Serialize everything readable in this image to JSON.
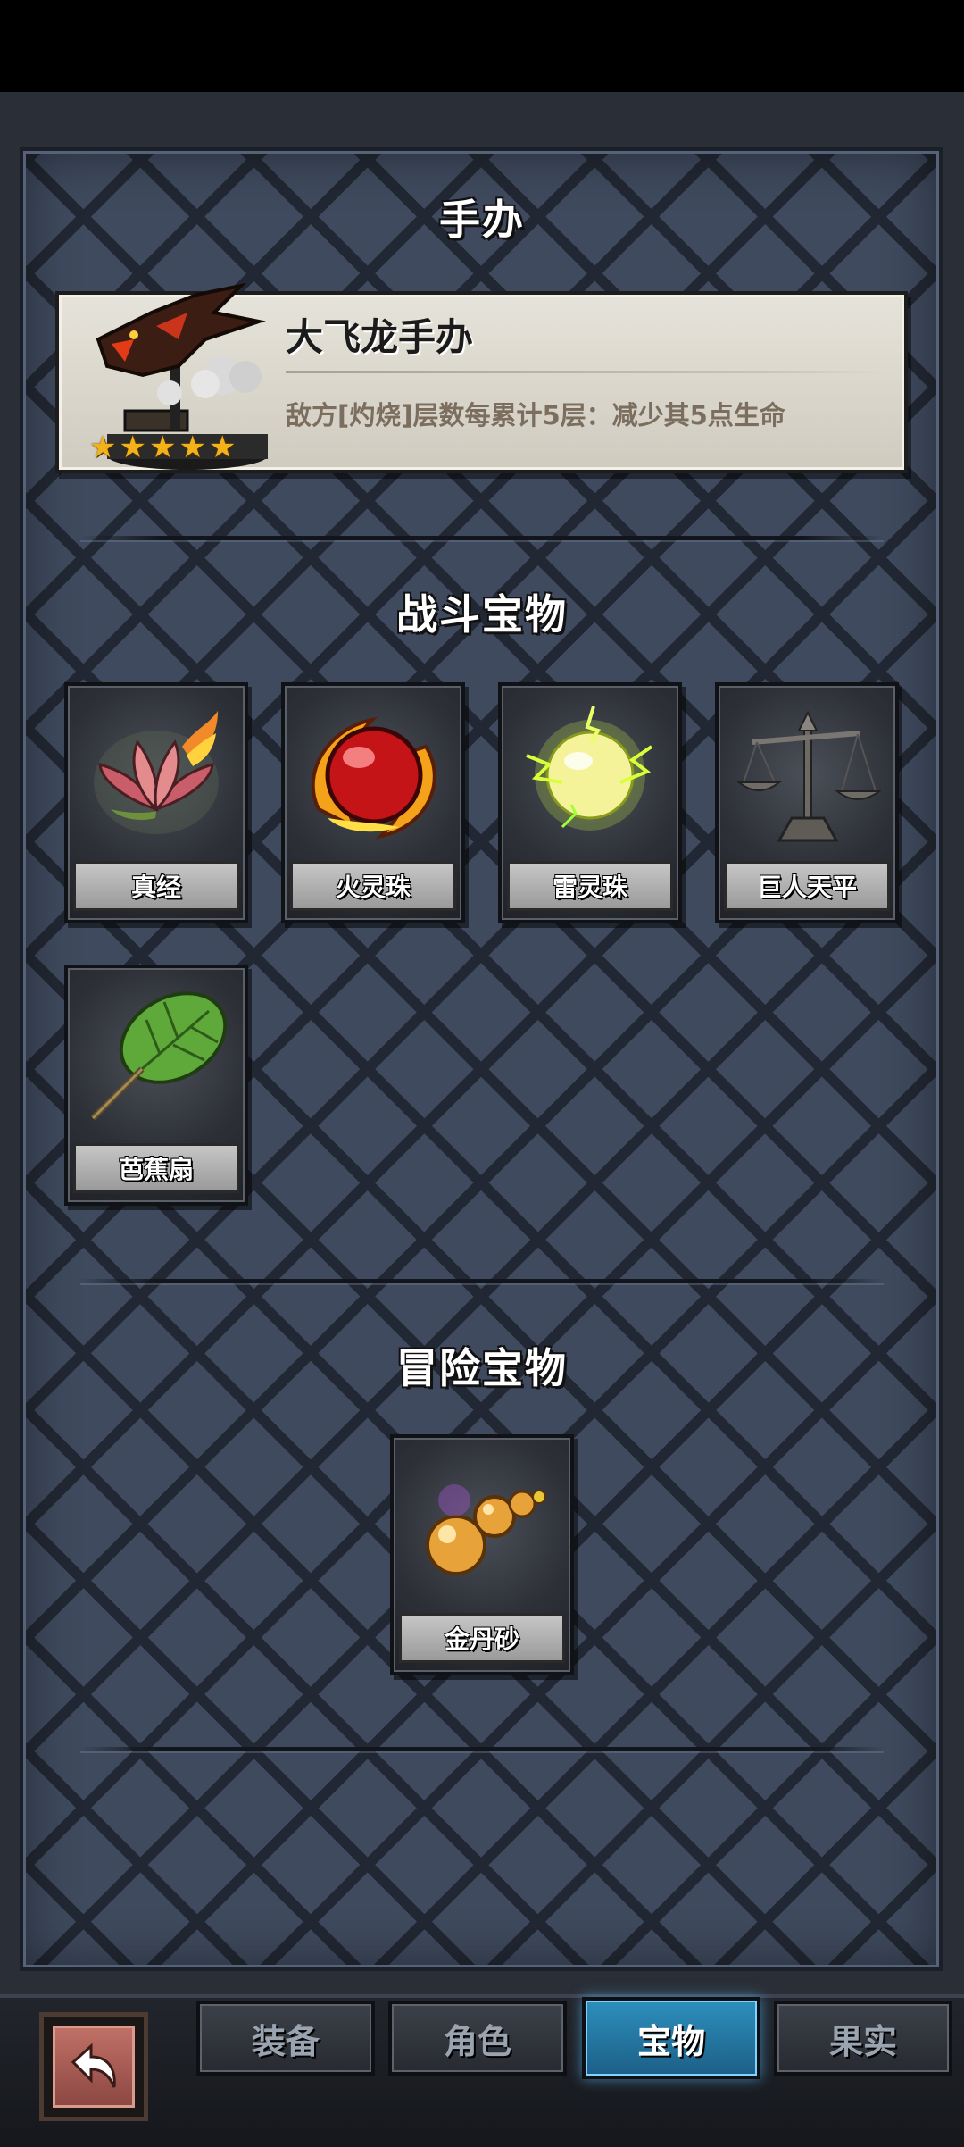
{
  "sections": {
    "figure_title": "手办",
    "battle_title": "战斗宝物",
    "adventure_title": "冒险宝物"
  },
  "figure": {
    "name": "大飞龙手办",
    "description": "敌方[灼烧]层数每累计5层：减少其5点生命",
    "stars": 5,
    "star_glyph": "★"
  },
  "battle_treasures": [
    {
      "name": "真经",
      "icon": "lotus-icon"
    },
    {
      "name": "火灵珠",
      "icon": "fire-orb-icon"
    },
    {
      "name": "雷灵珠",
      "icon": "thunder-orb-icon"
    },
    {
      "name": "巨人天平",
      "icon": "scales-icon"
    },
    {
      "name": "芭蕉扇",
      "icon": "banana-fan-icon"
    }
  ],
  "adventure_treasures": [
    {
      "name": "金丹砂",
      "icon": "golden-pills-icon"
    }
  ],
  "nav": {
    "tabs": [
      "装备",
      "角色",
      "宝物",
      "果实"
    ],
    "active_index": 2,
    "back_icon": "back-arrow-icon"
  },
  "colors": {
    "panel": "#3f4a5e",
    "active_tab": "#2d8fbd",
    "star": "#f3b21b",
    "description_text": "#7b6e5f"
  }
}
